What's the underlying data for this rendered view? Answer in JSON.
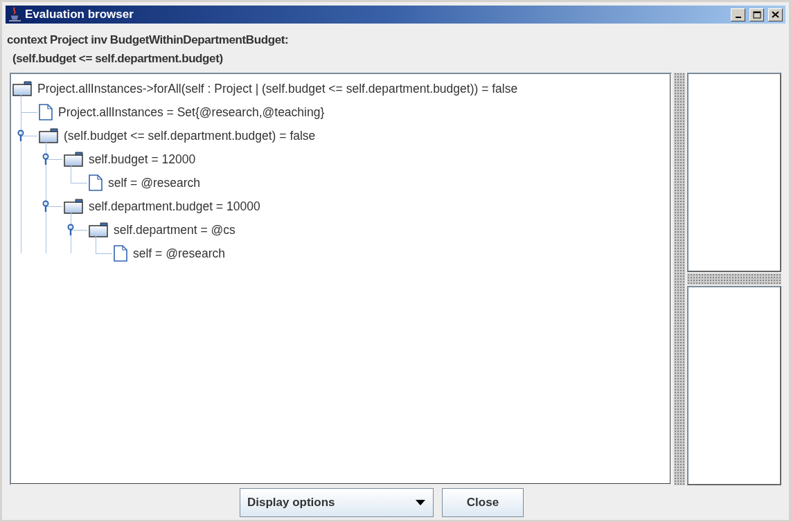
{
  "window": {
    "title": "Evaluation browser"
  },
  "header": {
    "lines": [
      "context Project inv BudgetWithinDepartmentBudget:",
      "(self.budget <= self.department.budget)"
    ]
  },
  "tree": [
    {
      "kind": "folder",
      "label": "Project.allInstances->forAll(self : Project | (self.budget <= self.department.budget)) = false",
      "expanded": true,
      "children": [
        {
          "kind": "file",
          "label": "Project.allInstances = Set{@research,@teaching}"
        },
        {
          "kind": "folder",
          "label": "(self.budget <= self.department.budget) = false",
          "expanded": true,
          "children": [
            {
              "kind": "folder",
              "label": "self.budget = 12000",
              "expanded": true,
              "children": [
                {
                  "kind": "file",
                  "label": "self = @research"
                }
              ]
            },
            {
              "kind": "folder",
              "label": "self.department.budget = 10000",
              "expanded": true,
              "children": [
                {
                  "kind": "folder",
                  "label": "self.department = @cs",
                  "expanded": true,
                  "children": [
                    {
                      "kind": "file",
                      "label": "self = @research"
                    }
                  ]
                }
              ]
            }
          ]
        }
      ]
    }
  ],
  "buttons": {
    "dropdown": "Display options",
    "close": "Close"
  }
}
